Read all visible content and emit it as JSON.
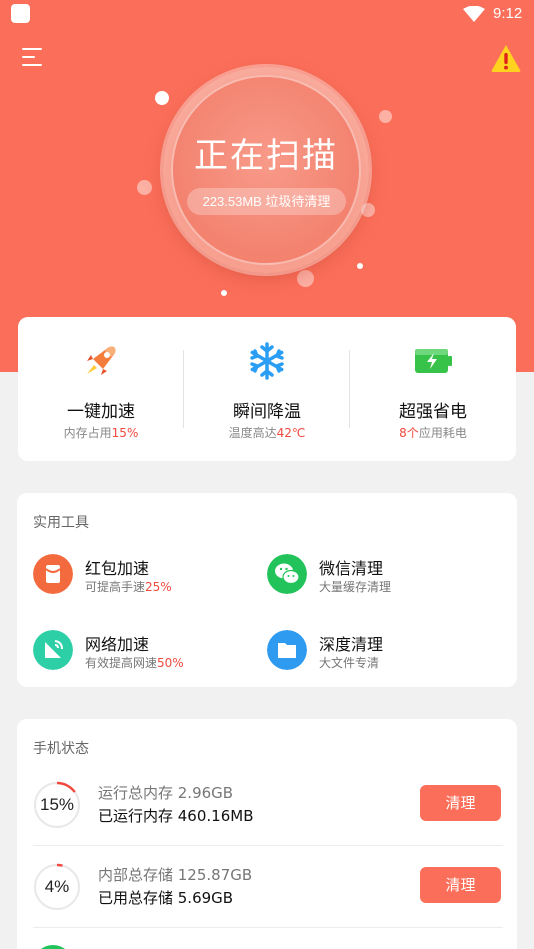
{
  "status_bar": {
    "time": "9:12"
  },
  "header": {
    "menu_icon": "hamburger-menu-icon",
    "warning_icon": "warning-triangle-icon",
    "scan_title": "正在扫描",
    "junk_text": "223.53MB 垃圾待清理"
  },
  "quick_actions": [
    {
      "icon": "rocket-icon",
      "title": "一键加速",
      "sub_prefix": "内存占用",
      "sub_highlight": "15%",
      "sub_suffix": ""
    },
    {
      "icon": "snowflake-icon",
      "title": "瞬间降温",
      "sub_prefix": "温度高达",
      "sub_highlight": "42℃",
      "sub_suffix": ""
    },
    {
      "icon": "battery-icon",
      "title": "超强省电",
      "sub_prefix": "",
      "sub_highlight": "8个",
      "sub_suffix": "应用耗电"
    }
  ],
  "tools": {
    "title": "实用工具",
    "items": [
      {
        "icon": "red-packet-icon",
        "name": "红包加速",
        "desc_prefix": "可提高手速",
        "desc_highlight": "25%",
        "color": "#f36a3e"
      },
      {
        "icon": "wechat-icon",
        "name": "微信清理",
        "desc_prefix": "大量缓存清理",
        "desc_highlight": "",
        "color": "#22c35a"
      },
      {
        "icon": "network-icon",
        "name": "网络加速",
        "desc_prefix": "有效提高网速",
        "desc_highlight": "50%",
        "color": "#2ccfa6"
      },
      {
        "icon": "folder-icon",
        "name": "深度清理",
        "desc_prefix": "大文件专清",
        "desc_highlight": "",
        "color": "#2f9bf0"
      }
    ]
  },
  "phone_status": {
    "title": "手机状态",
    "rows": [
      {
        "percent": "15%",
        "fill": 0.15,
        "line1": "运行总内存 2.96GB",
        "line2": "已运行内存 460.16MB",
        "button": "清理"
      },
      {
        "percent": "4%",
        "fill": 0.04,
        "line1": "内部总存储 125.87GB",
        "line2": "已用总存储 5.69GB",
        "button": "清理"
      }
    ]
  },
  "colors": {
    "accent": "#fb6f5a",
    "highlight": "#f0493d"
  }
}
